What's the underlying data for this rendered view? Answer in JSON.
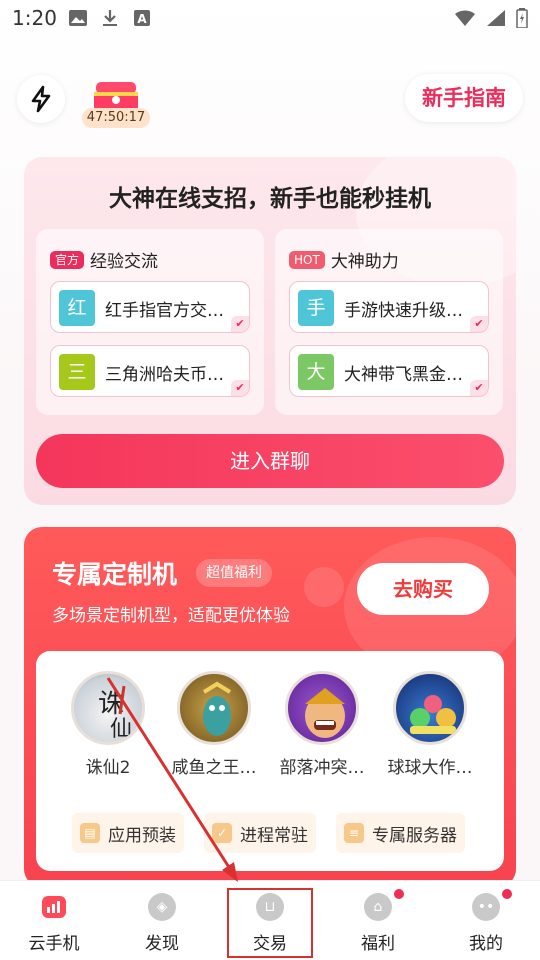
{
  "status_bar": {
    "time": "1:20"
  },
  "top": {
    "timer": "47:50:17",
    "guide_label": "新手指南"
  },
  "group_card": {
    "title": "大神在线支招，新手也能秒挂机",
    "panels": [
      {
        "tag": "官方",
        "name": "经验交流",
        "items": [
          {
            "avatar": "红",
            "label": "红手指官方交…",
            "color": "#4ec6d8"
          },
          {
            "avatar": "三",
            "label": "三角洲哈夫币…",
            "color": "#a6c81a"
          }
        ]
      },
      {
        "tag": "HOT",
        "name": "大神助力",
        "items": [
          {
            "avatar": "手",
            "label": "手游快速升级…",
            "color": "#4ec6d8"
          },
          {
            "avatar": "大",
            "label": "大神带飞黑金…",
            "color": "#7cc864"
          }
        ]
      }
    ],
    "join_label": "进入群聊"
  },
  "custom_card": {
    "title": "专属定制机",
    "badge": "超值福利",
    "subtitle": "多场景定制机型，适配更优体验",
    "buy_label": "去购买",
    "games": [
      {
        "label": "诛仙2",
        "icon": "zhuxian-game-icon"
      },
      {
        "label": "咸鱼之王…",
        "icon": "salted-fish-game-icon"
      },
      {
        "label": "部落冲突…",
        "icon": "clash-game-icon"
      },
      {
        "label": "球球大作…",
        "icon": "ball-battle-game-icon"
      }
    ],
    "features": [
      {
        "label": "应用预装"
      },
      {
        "label": "进程常驻"
      },
      {
        "label": "专属服务器"
      }
    ]
  },
  "bottom_nav": {
    "items": [
      {
        "label": "云手机",
        "icon": "cloud-phone-icon",
        "active": true
      },
      {
        "label": "发现",
        "icon": "compass-icon"
      },
      {
        "label": "交易",
        "icon": "basket-icon"
      },
      {
        "label": "福利",
        "icon": "gift-icon",
        "dot": true
      },
      {
        "label": "我的",
        "icon": "profile-icon",
        "dot": true
      }
    ]
  },
  "colors": {
    "accent": "#ec2d5b",
    "custom_card": "#f7434f",
    "highlight": "#d93030"
  }
}
